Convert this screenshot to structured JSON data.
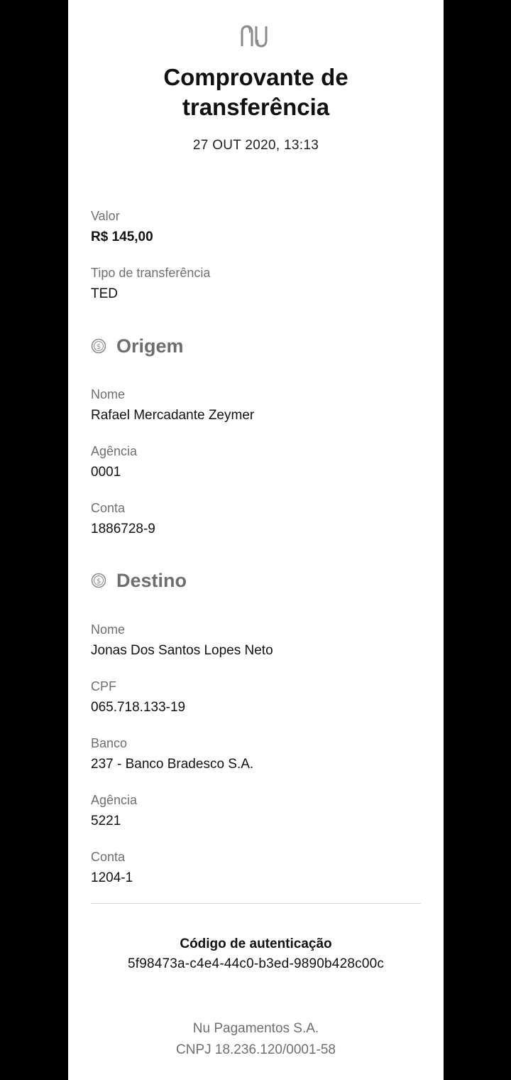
{
  "header": {
    "logo_icon": "nu-logo-icon",
    "title_line1": "Comprovante de",
    "title_line2": "transferência",
    "datetime": "27 OUT 2020, 13:13"
  },
  "summary": {
    "valor_label": "Valor",
    "valor_value": "R$ 145,00",
    "tipo_label": "Tipo de transferência",
    "tipo_value": "TED"
  },
  "origem": {
    "icon": "coin-icon",
    "heading": "Origem",
    "nome_label": "Nome",
    "nome_value": "Rafael Mercadante Zeymer",
    "agencia_label": "Agência",
    "agencia_value": "0001",
    "conta_label": "Conta",
    "conta_value": "1886728-9"
  },
  "destino": {
    "icon": "coin-icon",
    "heading": "Destino",
    "nome_label": "Nome",
    "nome_value": "Jonas Dos Santos Lopes Neto",
    "cpf_label": "CPF",
    "cpf_value": "065.718.133-19",
    "banco_label": "Banco",
    "banco_value": "237 - Banco Bradesco S.A.",
    "agencia_label": "Agência",
    "agencia_value": "5221",
    "conta_label": "Conta",
    "conta_value": "1204-1"
  },
  "footer": {
    "auth_label": "Código de autenticação",
    "auth_code": "5f98473a-c4e4-44c0-b3ed-9890b428c00c",
    "company": "Nu Pagamentos S.A.",
    "cnpj": "CNPJ 18.236.120/0001-58"
  },
  "colors": {
    "background": "#000000",
    "card": "#ffffff",
    "text_primary": "#111111",
    "text_secondary": "#6f6f6f",
    "divider": "#d6d6d6"
  }
}
